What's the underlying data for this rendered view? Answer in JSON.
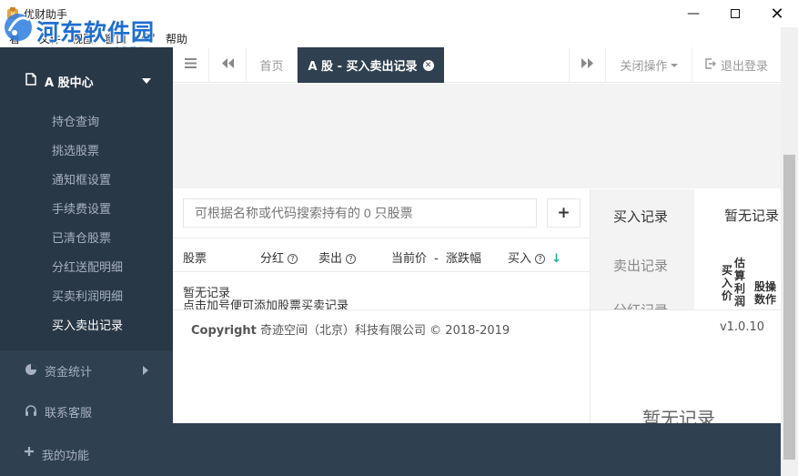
{
  "window": {
    "title": "优财助手"
  },
  "watermark": {
    "text": "河东软件园",
    "url": "www.pc0359.cn"
  },
  "menu": [
    "看",
    "文件",
    "视图",
    "窗口",
    "VIP",
    "帮助"
  ],
  "sidebar": {
    "section": "A 股中心",
    "items": [
      "持仓查询",
      "挑选股票",
      "通知框设置",
      "手续费设置",
      "已清仓股票",
      "分红送配明细",
      "买卖利润明细",
      "买入卖出记录"
    ],
    "funds": "资金统计",
    "support": "联系客服",
    "my": "我的功能"
  },
  "tabs": {
    "home": "首页",
    "active": "A 股 - 买入卖出记录",
    "close_ops": "关闭操作",
    "logout": "退出登录"
  },
  "search": {
    "placeholder": "可根据名称或代码搜索持有的 0 只股票"
  },
  "table": {
    "headers": [
      "股票",
      "分红",
      "卖出",
      "当前价",
      "-",
      "涨跌幅",
      "买入"
    ],
    "empty": "暂无记录",
    "hint": "点击加号便可添加股票买卖记录"
  },
  "right_panel": {
    "tabs": [
      "买入记录",
      "卖出记录",
      "分红记录"
    ],
    "empty_head": "暂无记录",
    "col1": [
      "买",
      "入",
      "价"
    ],
    "col2": [
      "估",
      "算",
      "利",
      "润"
    ],
    "col3": [
      "股",
      "数"
    ],
    "col4": [
      "操",
      "作"
    ],
    "bottom_empty": "暂无记录"
  },
  "footer": {
    "copyright_bold": "Copyright",
    "copyright": "奇迹空间（北京）科技有限公司 © 2018-2019",
    "version": "v1.0.10"
  },
  "colors": {
    "sidebar": "#2f4050",
    "accent_green": "#1ab394"
  }
}
